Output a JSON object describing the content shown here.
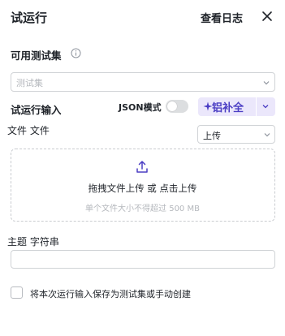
{
  "header": {
    "title": "试运行",
    "logs_label": "查看日志",
    "close_icon": "close-icon"
  },
  "test_set": {
    "label": "可用测试集",
    "info_icon": "info-circle-icon",
    "placeholder": "测试集"
  },
  "run_input": {
    "label": "试运行输入",
    "json_mode_label": "JSON模式",
    "json_mode_on": false,
    "ai_fill_label": "铝补全",
    "ai_fill_icon": "sparkle-icon",
    "more_icon": "chevron-down-icon"
  },
  "file_field": {
    "label": "文件 文件",
    "mode_value": "上传",
    "upload_icon": "upload-icon",
    "drop_text": "拖拽文件上传 或 点击上传",
    "limit_text": "单个文件大小不得超过 500 MB"
  },
  "string_field": {
    "label": "主题 字符串",
    "value": ""
  },
  "save_option": {
    "checked": false,
    "label": "将本次运行输入保存为测试集或手动创建"
  },
  "colors": {
    "accent": "#4b3ec4",
    "accent_bg": "#ebe7fb",
    "border": "#d0d3d6",
    "placeholder": "#b5b8bd",
    "text": "#1f2329"
  }
}
